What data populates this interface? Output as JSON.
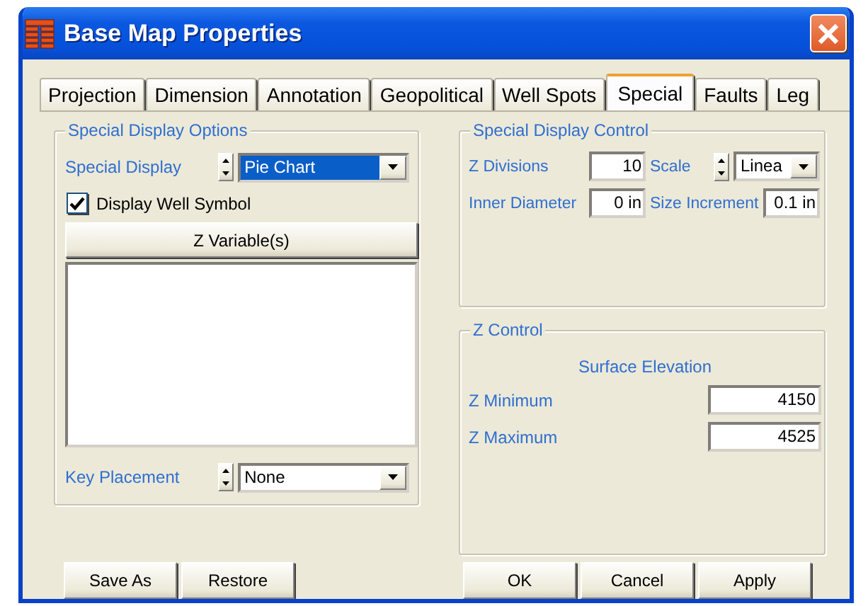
{
  "window": {
    "title": "Base Map Properties"
  },
  "tabs": [
    {
      "label": "Projection",
      "selected": false
    },
    {
      "label": "Dimension",
      "selected": false
    },
    {
      "label": "Annotation",
      "selected": false
    },
    {
      "label": "Geopolitical",
      "selected": false
    },
    {
      "label": "Well Spots",
      "selected": false
    },
    {
      "label": "Special",
      "selected": true
    },
    {
      "label": "Faults",
      "selected": false
    },
    {
      "label": "Leg",
      "selected": false
    }
  ],
  "special_display_options": {
    "title": "Special Display Options",
    "special_display": {
      "label": "Special Display",
      "value": "Pie Chart",
      "focused": true
    },
    "display_well_symbol": {
      "label": "Display Well Symbol",
      "checked": true
    },
    "z_variables_button": "Z Variable(s)",
    "key_placement": {
      "label": "Key Placement",
      "value": "None",
      "focused": false
    }
  },
  "special_display_control": {
    "title": "Special Display Control",
    "fields": [
      {
        "kind": "text",
        "label": "Z Divisions",
        "value": "10"
      },
      {
        "kind": "dropdown",
        "label": "Scale",
        "value": "Linea"
      },
      {
        "kind": "text",
        "label": "Inner Diameter",
        "value": "0 in"
      },
      {
        "kind": "text",
        "label": "Size Increment",
        "value": "0.1 in"
      }
    ]
  },
  "z_control": {
    "title": "Z Control",
    "heading": "Surface Elevation",
    "fields": [
      {
        "label": "Z Minimum",
        "value": "4150"
      },
      {
        "label": "Z Maximum",
        "value": "4525"
      }
    ]
  },
  "buttons_left": [
    "Save As",
    "Restore"
  ],
  "buttons_right": [
    "OK",
    "Cancel",
    "Apply"
  ]
}
